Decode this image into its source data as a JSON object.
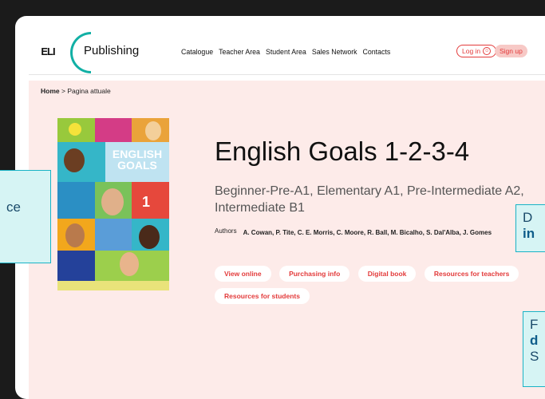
{
  "header": {
    "logo_mark": "ELI",
    "logo_text": "Publishing",
    "nav": [
      "Catalogue",
      "Teacher Area",
      "Student Area",
      "Sales Network",
      "Contacts"
    ],
    "login_label": "Log in",
    "signup_label": "Sign up"
  },
  "breadcrumb": {
    "home": "Home",
    "separator": ">",
    "current": "Pagina attuale"
  },
  "cover": {
    "title_line1": "ENGLISH",
    "title_line2": "GOALS",
    "number": "1"
  },
  "book": {
    "title": "English Goals 1-2-3-4",
    "subtitle": "Beginner-Pre-A1, Elementary A1, Pre-Intermediate A2, Intermediate B1",
    "authors_label": "Authors",
    "authors": "A. Cowan, P. Tite, C. E. Morris, C. Moore, R. Ball, M. Bicalho, S. Dal'Alba, J. Gomes"
  },
  "actions": [
    "View online",
    "Purchasing info",
    "Digital book",
    "Resources for teachers",
    "Resources for students"
  ],
  "callouts": {
    "left_text": "ce",
    "right1_line1": "D",
    "right1_line2": "in",
    "right2_line1": "F",
    "right2_line2": "d",
    "right2_line3": "S"
  },
  "colors": {
    "accent": "#e33b3b",
    "brand_teal": "#12b0a5",
    "content_bg": "#fdebe9",
    "callout_border": "#19b3c6"
  }
}
